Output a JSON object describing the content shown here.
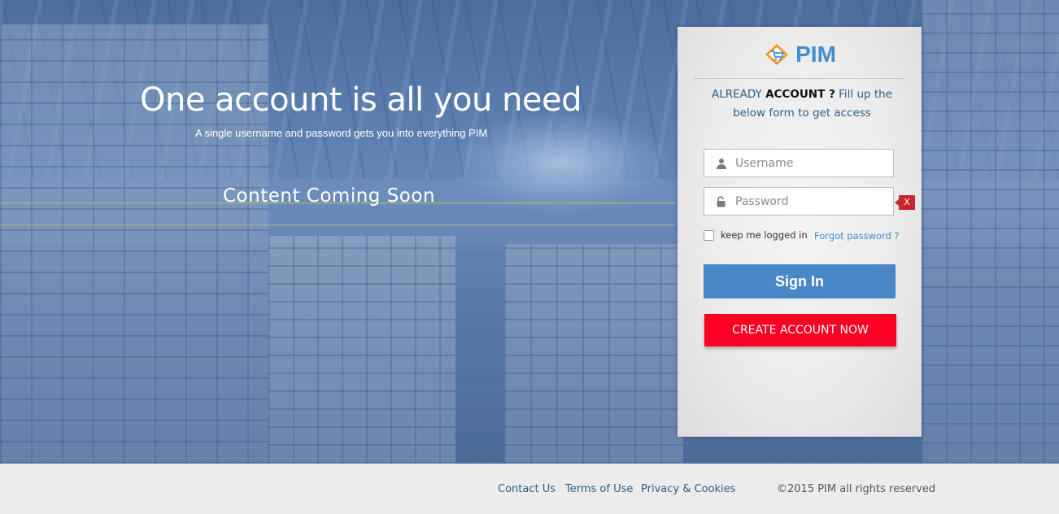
{
  "hero": {
    "headline": "One account is all you need",
    "subline": "A single username and password gets you into everything PIM",
    "coming_soon": "Content Coming Soon"
  },
  "login": {
    "brand": "PIM",
    "intro_prefix": "ALREADY ",
    "intro_bold": "ACCOUNT ?",
    "intro_suffix": " Fill up the below form to get access",
    "username_placeholder": "Username",
    "password_placeholder": "Password",
    "password_error_marker": "X",
    "remember_label": "keep me logged in",
    "forgot_label": "Forgot password ?",
    "signin_label": "Sign In",
    "create_label": "CREATE ACCOUNT NOW",
    "icons": {
      "username": "user-icon",
      "password": "lock-icon"
    },
    "colors": {
      "brand": "#3f8fd2",
      "signin": "#4a87c6",
      "create": "#fe0024",
      "error": "#c8262b"
    }
  },
  "footer": {
    "links": [
      "Contact Us",
      "Terms of Use",
      "Privacy & Cookies"
    ],
    "copyright": "©2015 PIM all rights reserved"
  }
}
